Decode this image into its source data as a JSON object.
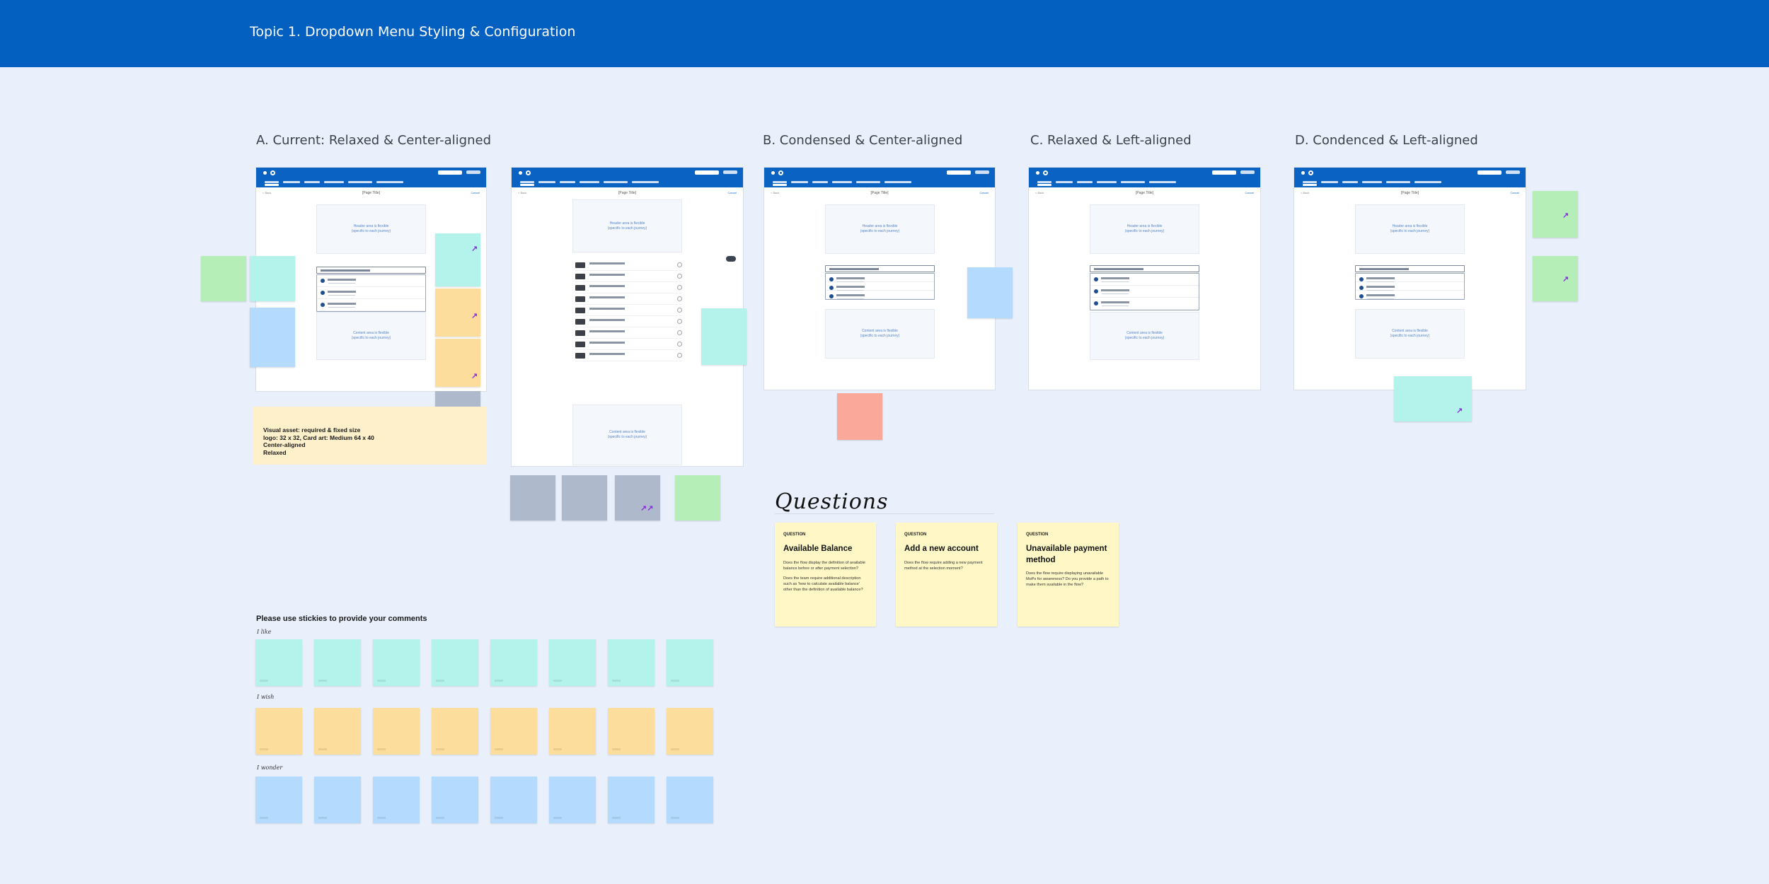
{
  "header": {
    "title": "Topic 1. Dropdown Menu Styling & Configuration"
  },
  "sections": {
    "a": "A. Current: Relaxed & Center-aligned",
    "b": "B. Condensed & Center-aligned",
    "c": "C. Relaxed & Left-aligned",
    "d": "D. Condenced & Left-aligned"
  },
  "mockup": {
    "page_title": "[Page Title]",
    "back": "< Back",
    "cancel": "Cancel",
    "header_area": "Header area is flexible",
    "header_area_sub": "(specific to each journey)",
    "content_area": "Content area is flexible",
    "content_area_sub": "(specific to each journey)",
    "pay_from": "Pay from"
  },
  "visual_asset": {
    "line1": "Visual asset: required & fixed size",
    "line2": "logo: 32 x 32,  Card art: Medium 64 x 40",
    "line3": "Center-aligned",
    "line4": "Relaxed"
  },
  "comments": {
    "title": "Please use stickies to provide your comments",
    "like": "I like",
    "wish": "I wish",
    "wonder": "I wonder"
  },
  "questions": {
    "heading": "Questions",
    "items": [
      {
        "label": "QUESTION",
        "title": "Available Balance",
        "body1": "Does the flow display the definition of available balance before or after payment selection?",
        "body2": "Does the team require additional description such as 'how to calculate available balance' other than the definition of available balance?"
      },
      {
        "label": "QUESTION",
        "title": "Add a new account",
        "body1": "Does the flow require adding a new payment method at the selection moment?",
        "body2": ""
      },
      {
        "label": "QUESTION",
        "title": "Unavailable payment method",
        "body1": "Does the flow require displaying unavailable MoPs for awareness? Do you provide a path to make them available in the flow?",
        "body2": ""
      }
    ]
  },
  "colors": {
    "banner": "#0460c0",
    "background": "#e9f0fc",
    "sticky_like": "#b3f3ec",
    "sticky_wish": "#fddd9b",
    "sticky_wonder": "#b4dbfd",
    "question_card": "#fff8c6"
  },
  "icons": [
    "logo-icon",
    "radio-icon",
    "toggle-icon",
    "checkmark-icon"
  ]
}
